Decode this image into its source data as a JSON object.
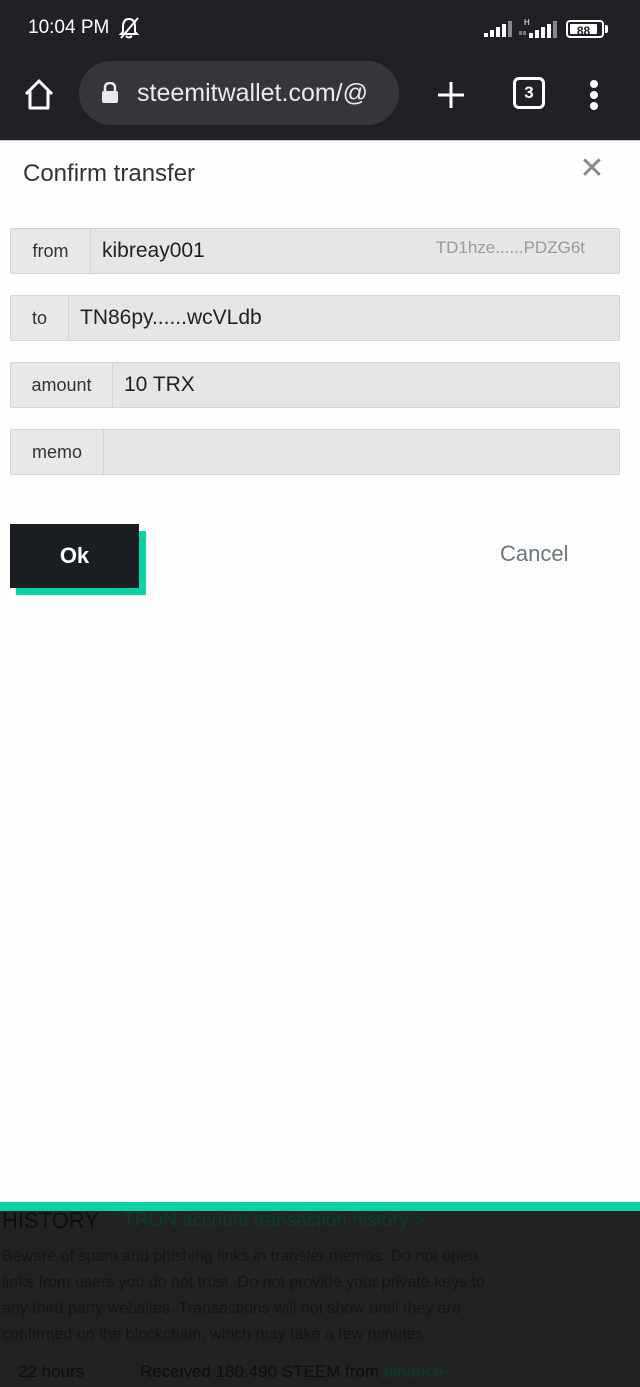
{
  "status_bar": {
    "time": "10:04 PM",
    "battery": "88",
    "network_label": "H"
  },
  "browser": {
    "url": "steemitwallet.com/@",
    "tab_count": "3"
  },
  "dialog": {
    "title": "Confirm transfer",
    "fields": [
      {
        "label": "from",
        "value": "kibreay001",
        "hint": "TD1hze......PDZG6t"
      },
      {
        "label": "to",
        "value": "TN86py......wcVLdb"
      },
      {
        "label": "amount",
        "value": "10  TRX"
      },
      {
        "label": "memo",
        "value": ""
      }
    ],
    "ok_label": "Ok",
    "cancel_label": "Cancel"
  },
  "background": {
    "history_title": "HISTORY",
    "tron_link": "TRON account transaction history >",
    "warning": "Beware of spam and phishing links in transfer memos. Do not open links from users you do not trust. Do not provide your private keys to any third party websites. Transactions will not show until they are confirmed on the blockchain, which may take a few minutes.",
    "history_items": [
      {
        "time": "22 hours",
        "text": "Received 180.490 STEEM from ",
        "link": "binance-"
      }
    ]
  },
  "colors": {
    "accent": "#07d2a8",
    "button_dark": "#1a1e23",
    "browser_chrome": "#202124"
  }
}
